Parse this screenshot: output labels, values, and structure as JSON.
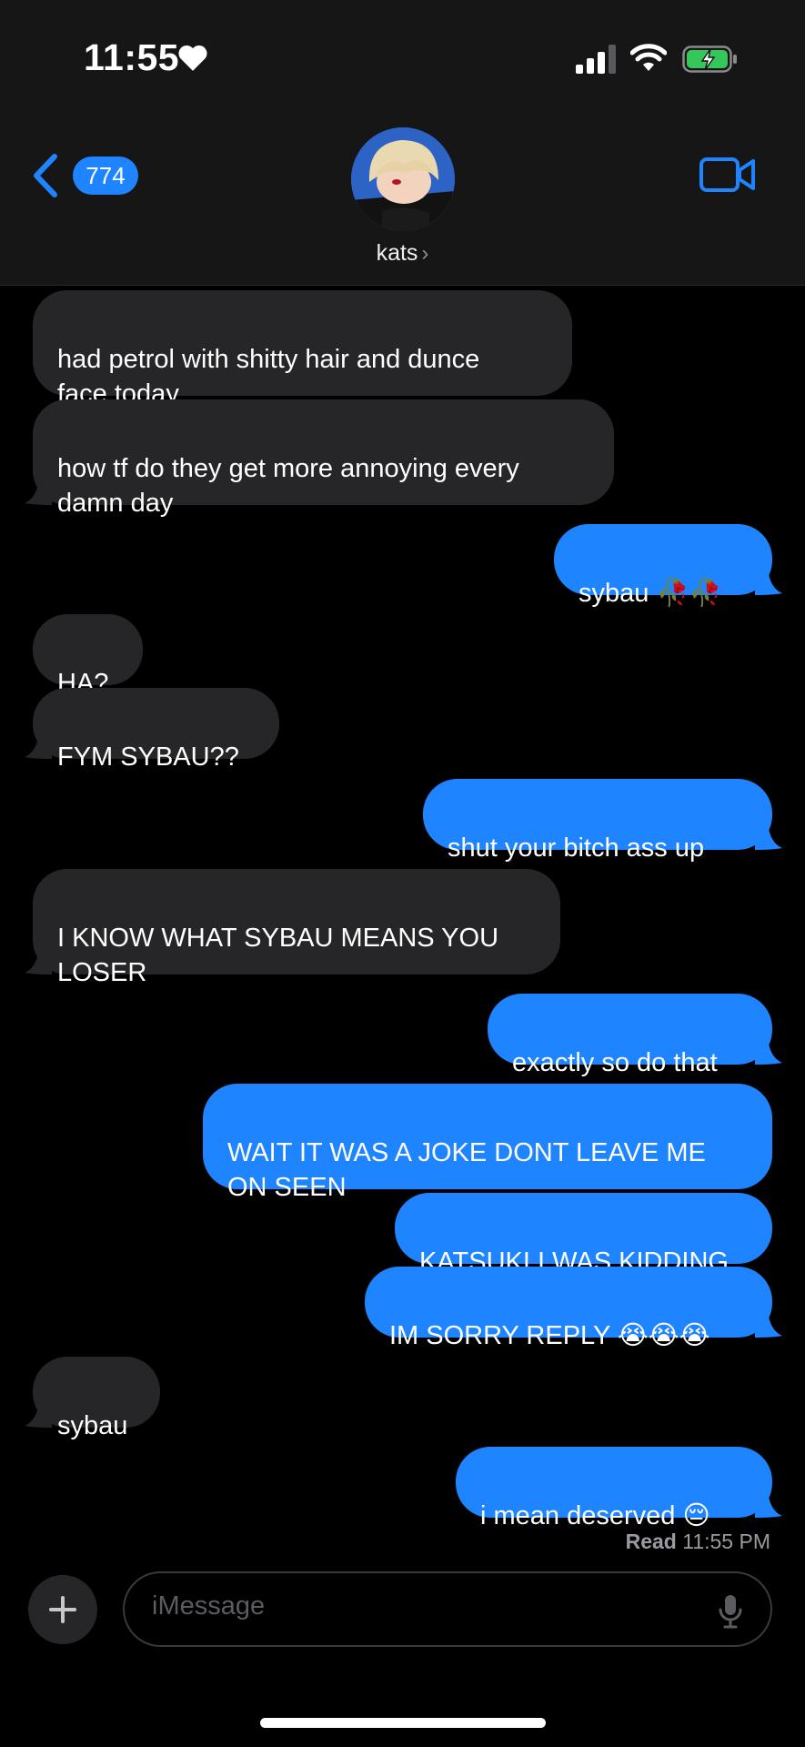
{
  "status_bar": {
    "time": "11:55",
    "icons": [
      "heart-icon",
      "cellular-signal-icon",
      "wifi-icon",
      "battery-charging-icon"
    ]
  },
  "header": {
    "back_badge": "774",
    "contact_name": "kats",
    "icons": [
      "chevron-left-icon",
      "video-camera-icon",
      "chevron-right-icon"
    ]
  },
  "messages": [
    {
      "sender": "them",
      "text": "had petrol with shitty hair and dunce\nface today"
    },
    {
      "sender": "them",
      "text": "how tf do they get more annoying every\ndamn day"
    },
    {
      "sender": "me",
      "text": "sybau 🥀🥀"
    },
    {
      "sender": "them",
      "text": "HA?"
    },
    {
      "sender": "them",
      "text": "FYM SYBAU??"
    },
    {
      "sender": "me",
      "text": "shut your bitch ass up"
    },
    {
      "sender": "them",
      "text": "I KNOW WHAT SYBAU MEANS YOU\nLOSER"
    },
    {
      "sender": "me",
      "text": "exactly so do that"
    },
    {
      "sender": "me",
      "text": "WAIT IT WAS A JOKE DONT LEAVE ME\nON SEEN"
    },
    {
      "sender": "me",
      "text": "KATSUKI I WAS KIDDING"
    },
    {
      "sender": "me",
      "text": "IM SORRY REPLY 😭😭😭"
    },
    {
      "sender": "them",
      "text": "sybau"
    },
    {
      "sender": "me",
      "text": "i mean deserved 😔"
    }
  ],
  "read_receipt": {
    "label": "Read",
    "time": "11:55 PM"
  },
  "composer": {
    "placeholder": "iMessage",
    "icons": [
      "plus-icon",
      "microphone-icon"
    ]
  },
  "colors": {
    "outgoing": "#1f84ff",
    "incoming": "#262628",
    "accent": "#1f84ff"
  }
}
